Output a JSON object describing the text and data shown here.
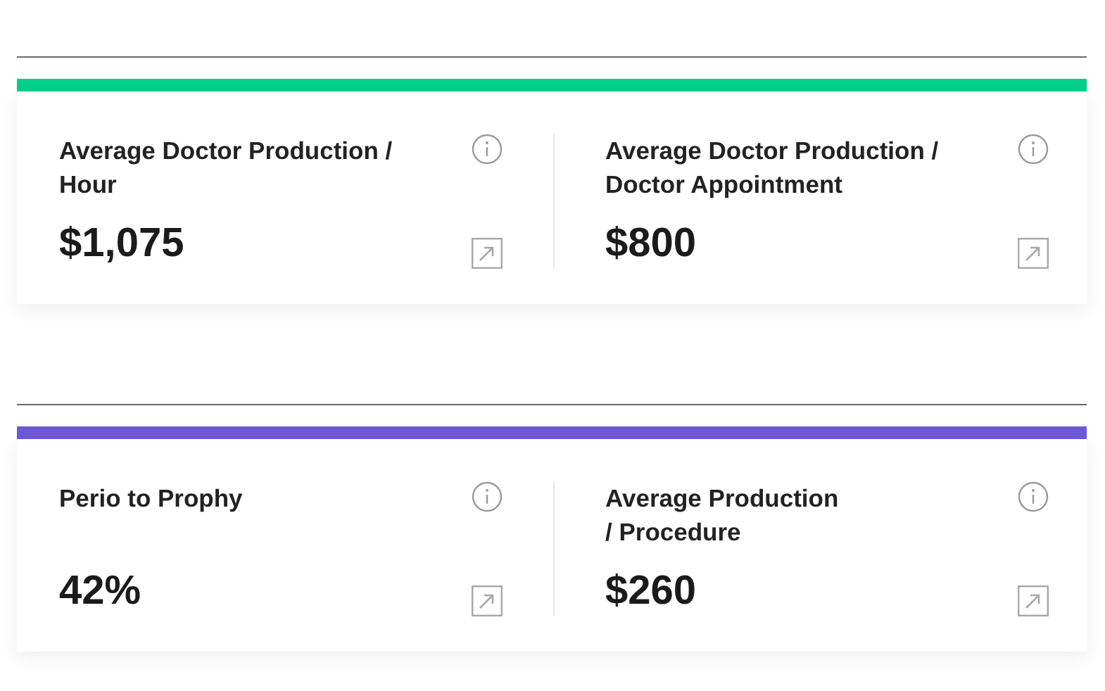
{
  "sections": [
    {
      "color": "#00d08a",
      "metrics": [
        {
          "title": "Average Doctor Production /\nHour",
          "value": "$1,075"
        },
        {
          "title": "Average Doctor Production /\nDoctor Appointment",
          "value": "$800"
        }
      ]
    },
    {
      "color": "#6f57d9",
      "metrics": [
        {
          "title": "Perio to Prophy",
          "value": "42%"
        },
        {
          "title": "Average Production\n/ Procedure",
          "value": "$260"
        }
      ]
    }
  ]
}
